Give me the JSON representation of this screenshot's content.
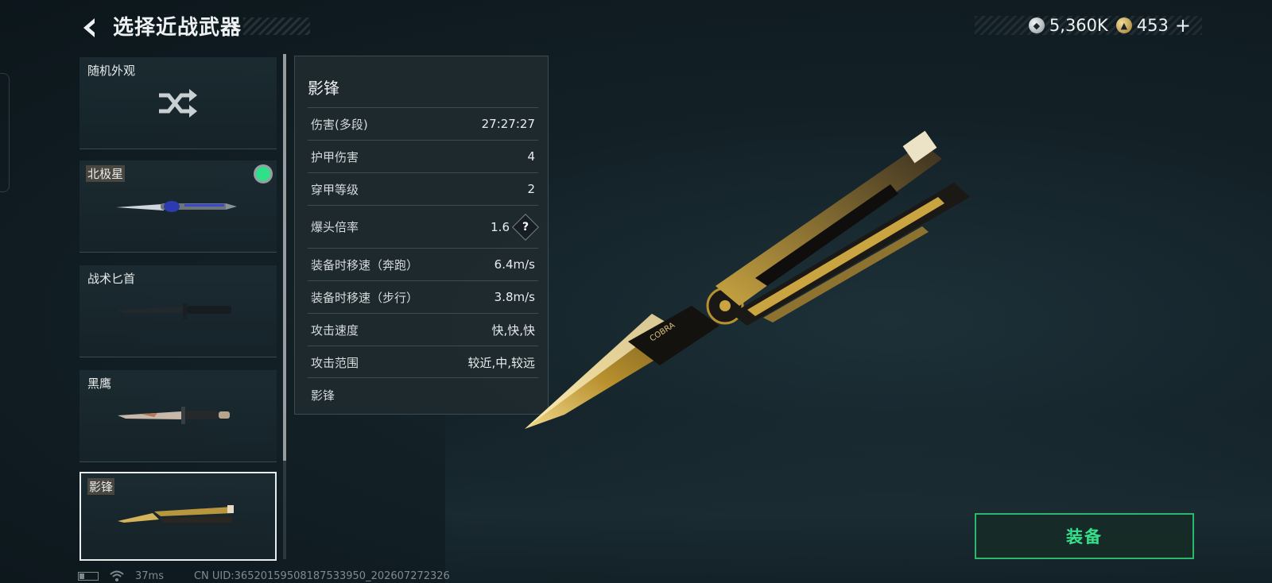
{
  "header": {
    "title": "选择近战武器"
  },
  "currency": {
    "silver_value": "5,360K",
    "gold_value": "453",
    "plus_label": "+"
  },
  "weapons": [
    {
      "label": "随机外观"
    },
    {
      "label": "北极星",
      "equipped": true
    },
    {
      "label": "战术匕首"
    },
    {
      "label": "黑鹰"
    },
    {
      "label": "影锋",
      "selected": true
    }
  ],
  "stats": {
    "name": "影锋",
    "rows": [
      {
        "label": "伤害(多段)",
        "value": "27:27:27"
      },
      {
        "label": "护甲伤害",
        "value": "4"
      },
      {
        "label": "穿甲等级",
        "value": "2"
      },
      {
        "label": "爆头倍率",
        "value": "1.6"
      },
      {
        "label": "装备时移速（奔跑）",
        "value": "6.4m/s"
      },
      {
        "label": "装备时移速（步行）",
        "value": "3.8m/s"
      },
      {
        "label": "攻击速度",
        "value": "快,快,快"
      },
      {
        "label": "攻击范围",
        "value": "较近,中,较远"
      }
    ],
    "help_label": "?",
    "footer": "影锋"
  },
  "preview": {
    "engraving": "COBRA"
  },
  "actions": {
    "equip_label": "装备"
  },
  "status": {
    "ping": "37ms",
    "uid": "CN UID:3652015950818753395​0_202607272326"
  },
  "colors": {
    "accent_green": "#37e08a",
    "equipped_dot": "#2fe08a",
    "gold": "#c9a441"
  }
}
